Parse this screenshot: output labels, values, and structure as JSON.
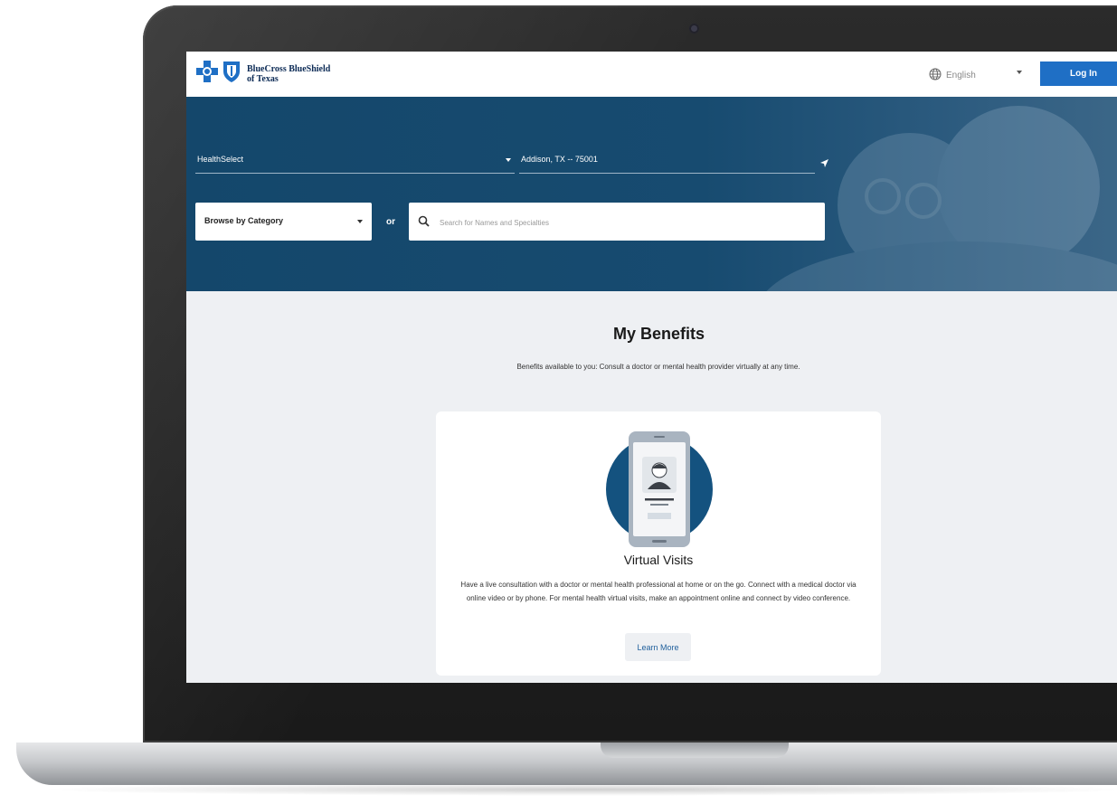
{
  "header": {
    "logo_line1": "BlueCross BlueShield",
    "logo_line2": "of Texas",
    "language": "English",
    "login_label": "Log In"
  },
  "search_panel": {
    "plan_value": "HealthSelect",
    "location_value": "Addison, TX -- 75001",
    "browse_label": "Browse by Category",
    "or_label": "or",
    "search_placeholder": "Search for Names and Specialties"
  },
  "benefits": {
    "title": "My Benefits",
    "description": "Benefits available to you: Consult a doctor or mental health provider virtually at any time.",
    "card": {
      "title": "Virtual Visits",
      "description": "Have a live consultation with a doctor or mental health professional at home or on the go. Connect with a medical doctor via online video or by phone. For mental health virtual visits, make an appointment online and connect by video conference.",
      "button_label": "Learn More"
    }
  },
  "icons": {
    "logo_cross": "cross-logo-icon",
    "logo_shield": "shield-logo-icon",
    "language": "globe-icon",
    "location": "location-arrow-icon",
    "search": "search-icon",
    "virtual_visit": "phone-doctor-icon"
  },
  "colors": {
    "brand_blue": "#1f6fc5",
    "hero_blue": "#14476b",
    "page_bg": "#eef0f3"
  }
}
